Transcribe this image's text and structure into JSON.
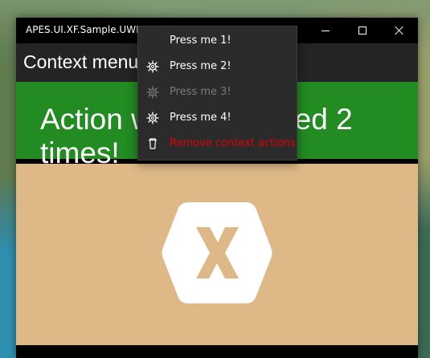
{
  "window": {
    "title": "APES.UI.XF.Sample.UWP"
  },
  "page": {
    "title": "Context menu",
    "banner_text": "Action was performed 2 times!",
    "content_color": "#deb887"
  },
  "context_menu": {
    "items": [
      {
        "label": "Press me 1!",
        "icon": "",
        "enabled": true
      },
      {
        "label": "Press me 2!",
        "icon": "gear-icon",
        "enabled": true
      },
      {
        "label": "Press me 3!",
        "icon": "gear-icon",
        "enabled": false
      },
      {
        "label": "Press me 4!",
        "icon": "gear-icon",
        "enabled": true
      },
      {
        "label": "Remove context actions",
        "icon": "trash-icon",
        "enabled": true,
        "danger": true
      }
    ]
  },
  "colors": {
    "banner": "#228b22",
    "navbar": "#242424",
    "danger": "#e00000"
  }
}
